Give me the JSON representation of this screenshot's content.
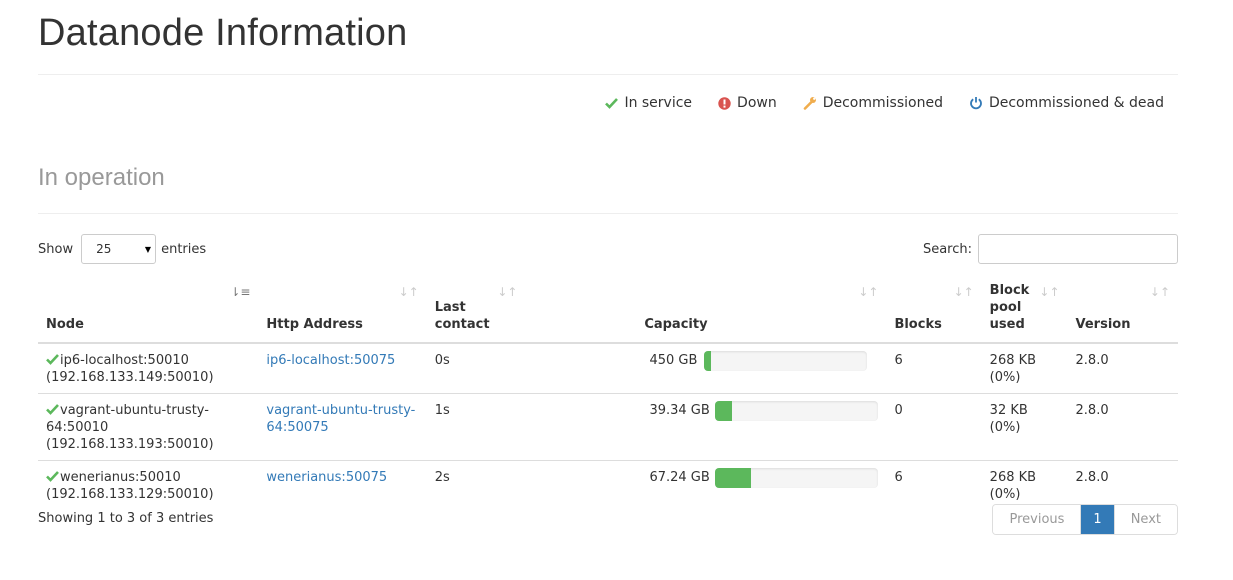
{
  "page": {
    "title": "Datanode Information",
    "section_title": "In operation"
  },
  "legend": [
    {
      "icon": "check-icon",
      "label": "In service",
      "color": "#5cb85c"
    },
    {
      "icon": "exclamation-circle-icon",
      "label": "Down",
      "color": "#d9534f"
    },
    {
      "icon": "wrench-icon",
      "label": "Decommissioned",
      "color": "#f0ad4e"
    },
    {
      "icon": "power-off-icon",
      "label": "Decommissioned & dead",
      "color": "#337ab7"
    }
  ],
  "controls": {
    "show_label": "Show",
    "entries_value": "25",
    "entries_label": "entries",
    "search_label": "Search:"
  },
  "table": {
    "headers": {
      "node": "Node",
      "http": "Http Address",
      "last_contact_1": "Last",
      "last_contact_2": "contact",
      "capacity": "Capacity",
      "blocks": "Blocks",
      "pool_1": "Block",
      "pool_2": "pool",
      "pool_3": "used",
      "version": "Version"
    },
    "rows": [
      {
        "node": "ip6-localhost:50010",
        "ip": "(192.168.133.149:50010)",
        "http_1": "ip6-localhost:50075",
        "http_2": "",
        "last_contact": "0s",
        "capacity": "450 GB",
        "used_fraction": 0.04,
        "blocks": "6",
        "pool_used": "268 KB (0%)",
        "version": "2.8.0"
      },
      {
        "node": "vagrant-ubuntu-trusty-64:50010",
        "ip": "(192.168.133.193:50010)",
        "http_1": "vagrant-ubuntu-trusty-",
        "http_2": "64:50075",
        "last_contact": "1s",
        "capacity": "39.34 GB",
        "used_fraction": 0.1,
        "blocks": "0",
        "pool_used": "32 KB (0%)",
        "version": "2.8.0"
      },
      {
        "node": "wenerianus:50010",
        "ip": "(192.168.133.129:50010)",
        "http_1": "wenerianus:50075",
        "http_2": "",
        "last_contact": "2s",
        "capacity": "67.24 GB",
        "used_fraction": 0.22,
        "blocks": "6",
        "pool_used": "268 KB (0%)",
        "version": "2.8.0"
      }
    ]
  },
  "footer": {
    "info": "Showing 1 to 3 of 3 entries",
    "previous": "Previous",
    "page": "1",
    "next": "Next"
  }
}
